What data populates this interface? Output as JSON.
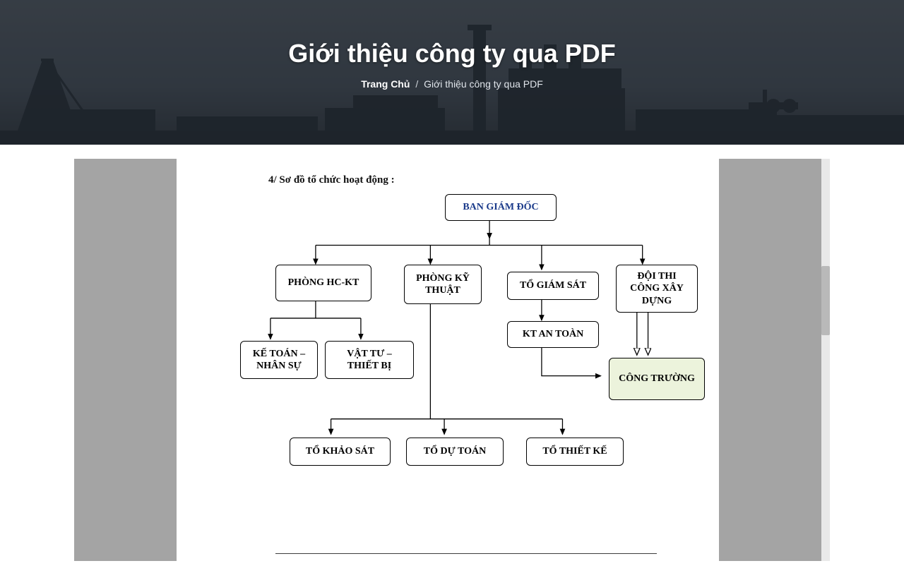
{
  "hero": {
    "title": "Giới thiệu công ty qua PDF",
    "breadcrumb_home": "Trang Chủ",
    "breadcrumb_sep": "/",
    "breadcrumb_current": "Giới thiệu công ty qua PDF"
  },
  "doc": {
    "section_heading": "4/ Sơ đồ tổ chức hoạt động :"
  },
  "org": {
    "root": "BAN GIÁM ĐỐC",
    "phong_hc_kt": "PHÒNG HC-KT",
    "phong_ky_thuat": "PHÒNG KỸ THUẬT",
    "to_giam_sat": "TỔ GIÁM SÁT",
    "doi_thi_cong": "ĐỘI THI CÔNG XÂY DỰNG",
    "ke_toan": "KẾ TOÁN – NHÂN SỰ",
    "vat_tu": "VẬT TƯ – THIẾT BỊ",
    "kt_an_toan": "KT AN TOÀN",
    "cong_truong": "CÔNG TRƯỜNG",
    "to_khao_sat": "TỔ KHẢO SÁT",
    "to_du_toan": "TỔ DỰ TOÁN",
    "to_thiet_ke": "TỔ THIẾT KẾ"
  }
}
